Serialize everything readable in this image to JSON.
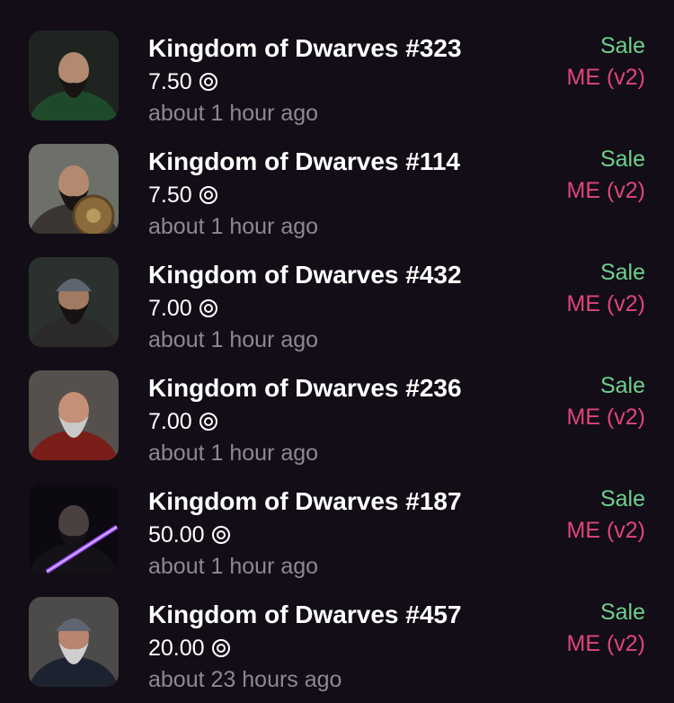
{
  "colors": {
    "background": "#120d17",
    "title": "#ffffff",
    "muted": "#8d8893",
    "sale": "#6fd08c",
    "market": "#e0457b"
  },
  "currency_icon": "sol-coin-icon",
  "items": [
    {
      "title": "Kingdom of Dwarves #323",
      "price": "7.50",
      "time": "about 1 hour ago",
      "type": "Sale",
      "market": "ME (v2)",
      "thumb": {
        "bg": "#1f2420",
        "beard": "#1a1414",
        "cloak": "#1f4a2a",
        "skin": "#b38a70"
      }
    },
    {
      "title": "Kingdom of Dwarves #114",
      "price": "7.50",
      "time": "about 1 hour ago",
      "type": "Sale",
      "market": "ME (v2)",
      "thumb": {
        "bg": "#6c7068",
        "beard": "#1a1414",
        "cloak": "#3a3530",
        "skin": "#b38a70"
      }
    },
    {
      "title": "Kingdom of Dwarves #432",
      "price": "7.00",
      "time": "about 1 hour ago",
      "type": "Sale",
      "market": "ME (v2)",
      "thumb": {
        "bg": "#2a312e",
        "beard": "#161212",
        "cloak": "#2c2a28",
        "skin": "#a07a62"
      }
    },
    {
      "title": "Kingdom of Dwarves #236",
      "price": "7.00",
      "time": "about 1 hour ago",
      "type": "Sale",
      "market": "ME (v2)",
      "thumb": {
        "bg": "#55504b",
        "beard": "#c9c9c9",
        "cloak": "#7a1e1a",
        "skin": "#c49076"
      }
    },
    {
      "title": "Kingdom of Dwarves #187",
      "price": "50.00",
      "time": "about 1 hour ago",
      "type": "Sale",
      "market": "ME (v2)",
      "thumb": {
        "bg": "#0c0a10",
        "beard": "#151217",
        "cloak": "#151217",
        "skin": "#4a4040"
      }
    },
    {
      "title": "Kingdom of Dwarves #457",
      "price": "20.00",
      "time": "about 23 hours ago",
      "type": "Sale",
      "market": "ME (v2)",
      "thumb": {
        "bg": "#4c4b4a",
        "beard": "#cfcfcf",
        "cloak": "#1c2230",
        "skin": "#b8866e"
      }
    }
  ]
}
